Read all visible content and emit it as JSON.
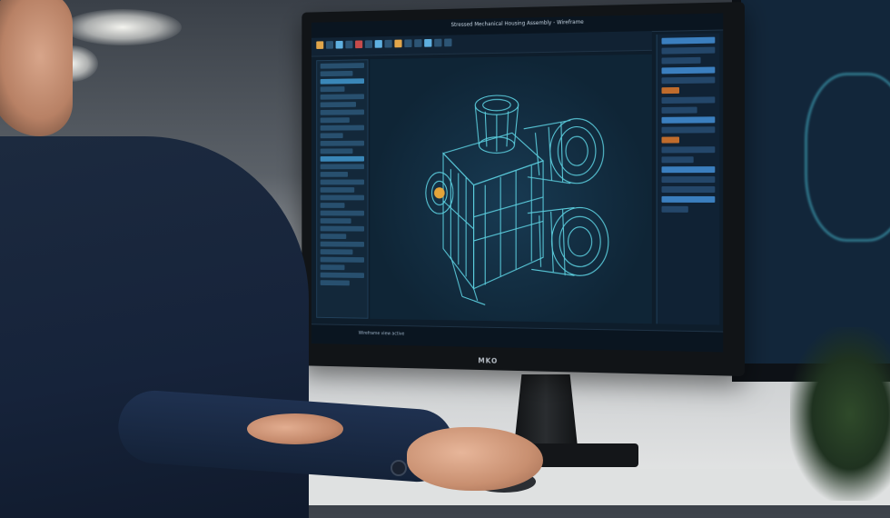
{
  "scene": {
    "monitor_brand": "MKO",
    "software_title_text": "Stressed Mechanical Housing Assembly - Wireframe",
    "status_text": "Wireframe view active"
  },
  "icons": [
    "viewport-wireframe-icon",
    "toolbar-tool-icons"
  ]
}
